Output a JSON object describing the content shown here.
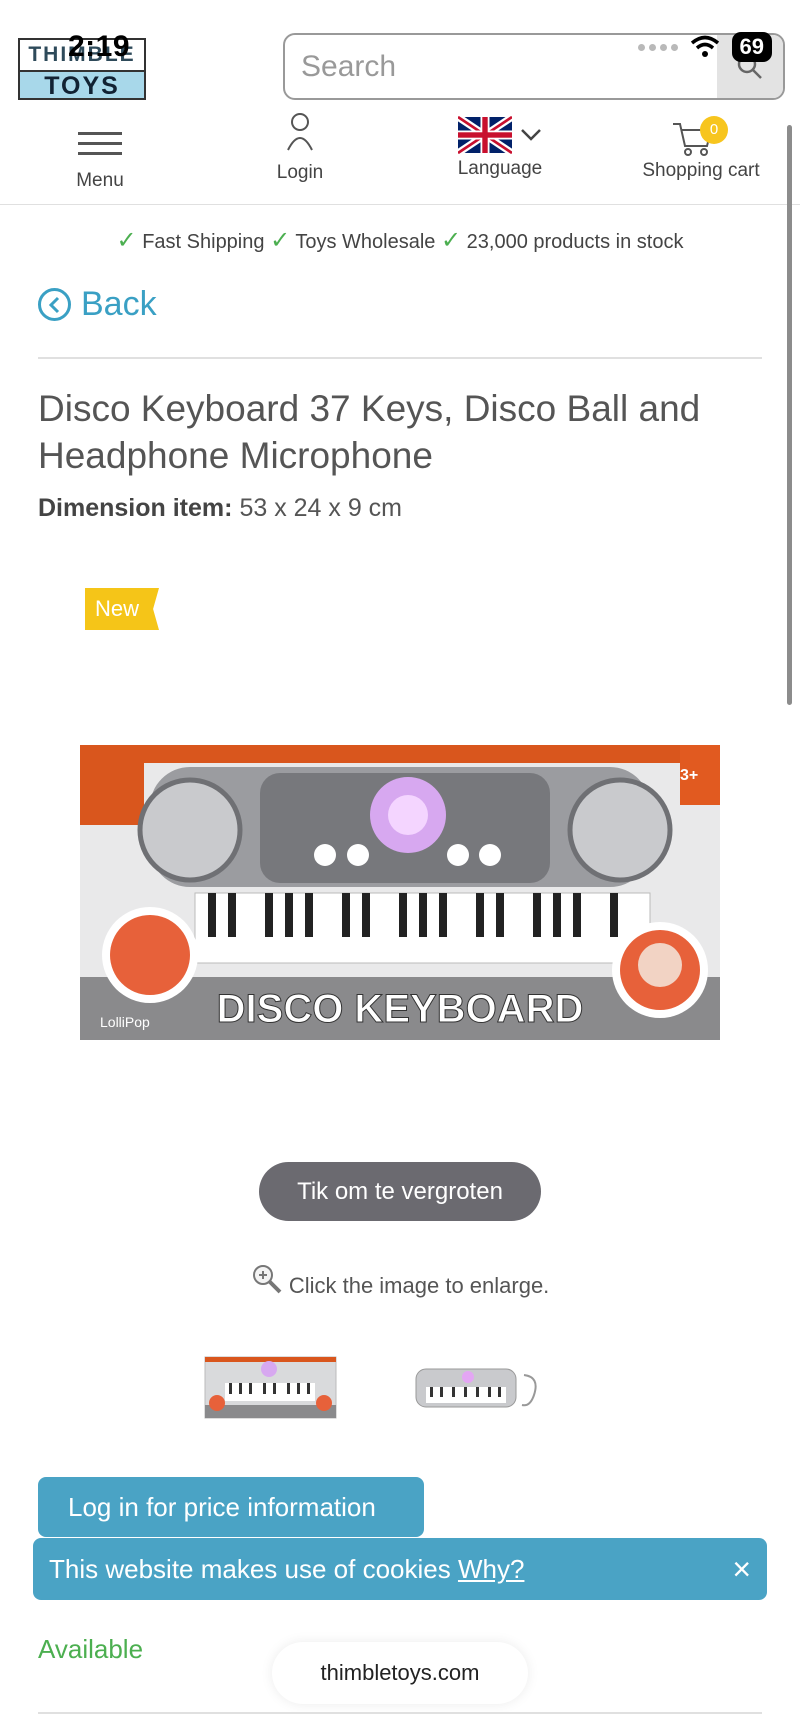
{
  "status_bar": {
    "time": "2:19",
    "battery": "69"
  },
  "header": {
    "logo_top": "THIMBLE",
    "logo_bottom": "TOYS",
    "search": {
      "placeholder": "Search"
    },
    "nav": {
      "menu": "Menu",
      "login": "Login",
      "language": "Language",
      "cart": "Shopping cart",
      "cart_count": "0"
    }
  },
  "usp": [
    "Fast Shipping",
    "Toys Wholesale",
    "23,000 products in stock"
  ],
  "back_label": "Back",
  "product": {
    "title": "Disco Keyboard 37 Keys, Disco Ball and Headphone Microphone",
    "dimension_label": "Dimension item:",
    "dimension_value": "53 x 24 x 9 cm",
    "badge": "New",
    "image_text": "DISCO KEYBOARD",
    "image_brand": "LolliPop",
    "image_age": "3+",
    "zoom_hint": "Tik om te vergroten",
    "enlarge_hint": "Click the image to enlarge.",
    "price_button": "Log in for price information",
    "availability": "Available"
  },
  "cookie": {
    "text": "This website makes use of cookies",
    "link": "Why?",
    "close": "×"
  },
  "browser": {
    "domain": "thimbletoys.com"
  },
  "colors": {
    "accent": "#4aa3c5",
    "check": "#4caf50",
    "badge": "#f5c518"
  }
}
